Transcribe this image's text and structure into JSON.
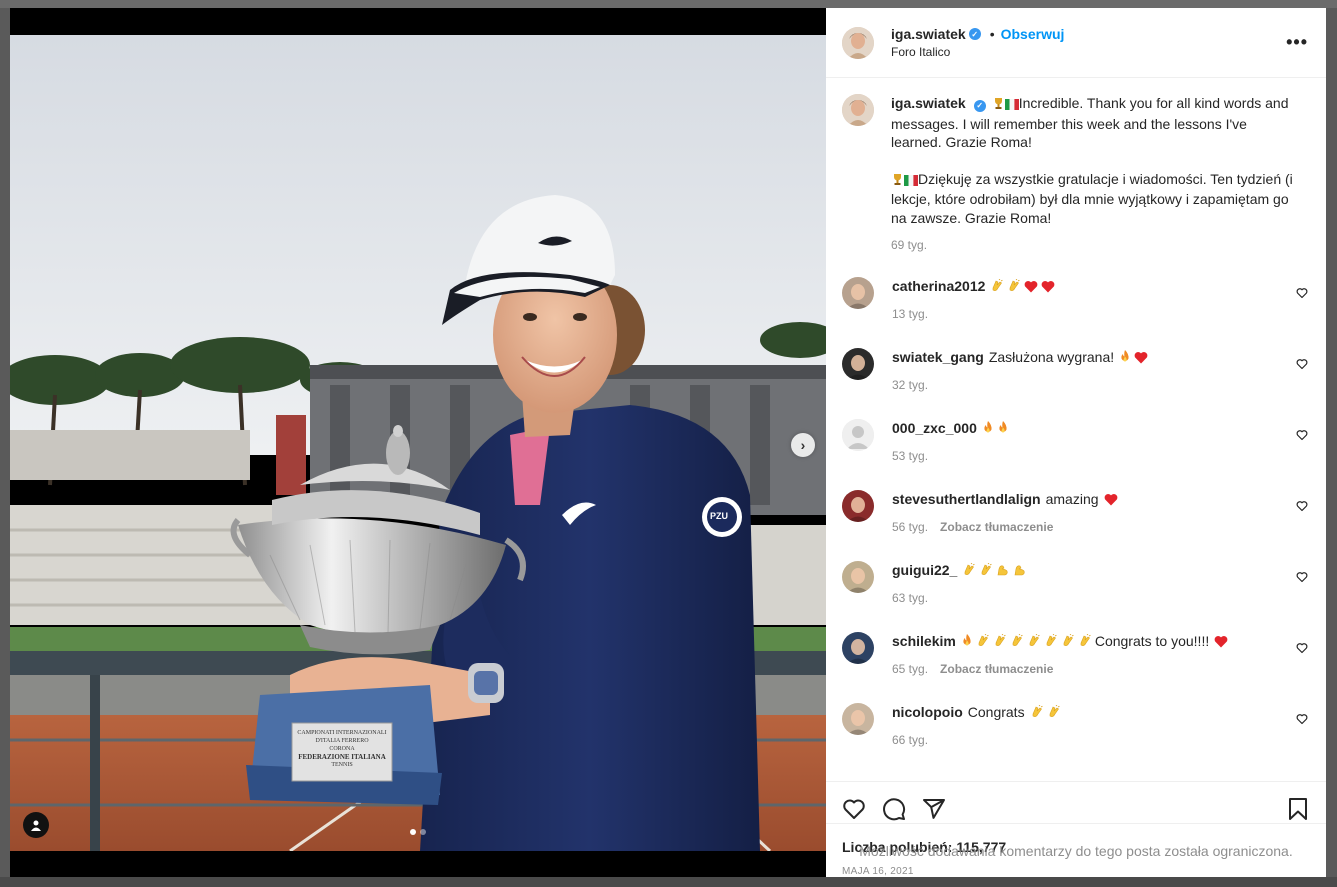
{
  "post": {
    "username": "iga.swiatek",
    "follow_label": "Obserwuj",
    "location": "Foro Italico",
    "more_label": "•••"
  },
  "caption": {
    "username": "iga.swiatek",
    "text_en": "Incredible. Thank you for all kind words and messages. I will remember this week and the lessons I've learned. Grazie Roma!",
    "text_pl": "Dziękuję za wszystkie gratulacje i wiadomości. Ten tydzień (i lekcje, które odrobiłam) był dla mnie wyjątkowy i zapamiętam go na zawsze. Grazie Roma!",
    "time": "69 tyg."
  },
  "comments": [
    {
      "username": "catherina2012",
      "emojis": [
        "clap",
        "clap",
        "heart",
        "heart"
      ],
      "text": "",
      "time": "13 tyg.",
      "translate": ""
    },
    {
      "username": "swiatek_gang",
      "text": "Zasłużona wygrana!",
      "emojis": [
        "fire",
        "heart"
      ],
      "time": "32 tyg.",
      "translate": ""
    },
    {
      "username": "000_zxc_000",
      "emojis": [
        "fire",
        "fire"
      ],
      "text": "",
      "time": "53 tyg.",
      "translate": ""
    },
    {
      "username": "stevesuthertlandlalign",
      "text": "amazing",
      "emojis": [
        "heart"
      ],
      "time": "56 tyg.",
      "translate": "Zobacz tłumaczenie"
    },
    {
      "username": "guigui22_",
      "emojis": [
        "clap",
        "clap",
        "muscle",
        "muscle"
      ],
      "text": "",
      "time": "63 tyg.",
      "translate": ""
    },
    {
      "username": "schilekim",
      "emojis": [
        "fire",
        "clap",
        "clap",
        "clap",
        "clap",
        "clap",
        "clap",
        "clap"
      ],
      "text": "Congrats to you!!!!",
      "trailing": [
        "heart"
      ],
      "time": "65 tyg.",
      "translate": "Zobacz tłumaczenie"
    },
    {
      "username": "nicolopoio",
      "text": "Congrats",
      "emojis": [
        "clap",
        "clap"
      ],
      "time": "66 tyg.",
      "translate": ""
    }
  ],
  "likes_text": "Liczba polubień: 115,777",
  "date": "MAJA 16, 2021",
  "restricted_text": "Możliwość dodawania komentarzy do tego posta została ograniczona.",
  "trophy_text": {
    "line1": "CAMPIONATI INTERNAZIONALI",
    "line2": "D'ITALIA FERRERO",
    "line3": "CORONA",
    "line4": "FEDERAZIONE ITALIANA",
    "line5": "TENNIS"
  },
  "sponsor": "PZU",
  "colors": {
    "accent": "#0095f6",
    "verified": "#3897f0",
    "heart": "#ed4956",
    "jacket": "#1b2a5c"
  },
  "icons": [
    "heart-icon",
    "comment-icon",
    "share-icon",
    "bookmark-icon",
    "chevron-right-icon",
    "user-tag-icon",
    "more-icon"
  ]
}
